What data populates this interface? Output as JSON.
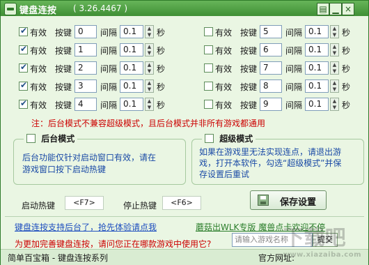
{
  "window": {
    "title": "键盘连按",
    "version": "( 3.26.4467 )",
    "buttons": {
      "menu": "▤",
      "minimize": "▁",
      "close": "×"
    }
  },
  "labels": {
    "valid": "有效",
    "key": "按键",
    "interval": "间隔",
    "sec": "秒"
  },
  "left_rows": [
    {
      "checked": true,
      "key": "0",
      "interval": "0.1"
    },
    {
      "checked": true,
      "key": "1",
      "interval": "0.1"
    },
    {
      "checked": true,
      "key": "2",
      "interval": "0.1"
    },
    {
      "checked": true,
      "key": "3",
      "interval": "0.1"
    },
    {
      "checked": true,
      "key": "4",
      "interval": "0.1"
    }
  ],
  "right_rows": [
    {
      "checked": false,
      "key": "5",
      "interval": "0.1"
    },
    {
      "checked": false,
      "key": "6",
      "interval": "0.1"
    },
    {
      "checked": false,
      "key": "7",
      "interval": "0.1"
    },
    {
      "checked": false,
      "key": "8",
      "interval": "0.1"
    },
    {
      "checked": false,
      "key": "9",
      "interval": "0.1"
    }
  ],
  "note": "注：后台模式不兼容超级模式，且后台模式并非所有游戏都通用",
  "background_mode": {
    "title": "后台模式",
    "desc_1": "后台功能仅针对启动窗口有效，请在",
    "desc_2": "游戏窗口按下启动热键"
  },
  "super_mode": {
    "title": "超级模式",
    "desc_1": "如果在游戏里无法实现连点，请退出游",
    "desc_2": "戏，打开本软件，勾选“超级模式”并保",
    "desc_3": "存设置后重试"
  },
  "hotkeys": {
    "start_label": "启动热键",
    "start_value": "<F7>",
    "stop_label": "停止热键",
    "stop_value": "<F6>"
  },
  "save_button": "保存设置",
  "links": {
    "left": "键盘连按支持后台了，抢先体验请点我",
    "right": "蘑菇出WLK专版 魔兽点卡欢迎不停"
  },
  "survey": {
    "question": "为更加完善键盘连按，请问您正在哪款游戏中使用它?",
    "placeholder": "请输入游戏名称",
    "submit": "提交"
  },
  "status": {
    "left": "简单百宝箱 - 键盘连按系列",
    "right": "官方网址:"
  },
  "watermark": {
    "main": "下载吧",
    "sub": "www.xiazaiba.com"
  }
}
